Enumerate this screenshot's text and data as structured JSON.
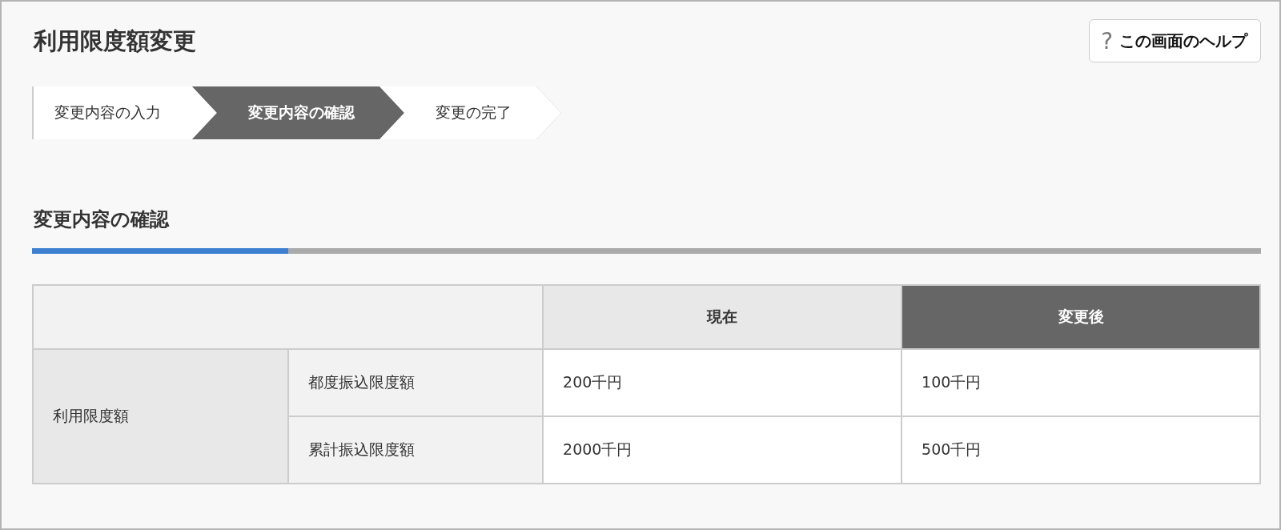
{
  "page": {
    "title": "利用限度額変更",
    "help_button": {
      "icon": "?",
      "label": "この画面のヘルプ"
    }
  },
  "steps": [
    {
      "label": "変更内容の入力",
      "selected": false
    },
    {
      "label": "変更内容の確認",
      "selected": true
    },
    {
      "label": "変更の完了",
      "selected": false
    }
  ],
  "section": {
    "title": "変更内容の確認"
  },
  "table": {
    "columns": [
      {
        "label": "現在",
        "highlighted": false
      },
      {
        "label": "変更後",
        "highlighted": true
      }
    ],
    "group_label": "利用限度額",
    "rows": [
      {
        "label": "都度振込限度額",
        "current": "200千円",
        "after": "100千円"
      },
      {
        "label": "累計振込限度額",
        "current": "2000千円",
        "after": "500千円"
      }
    ]
  }
}
